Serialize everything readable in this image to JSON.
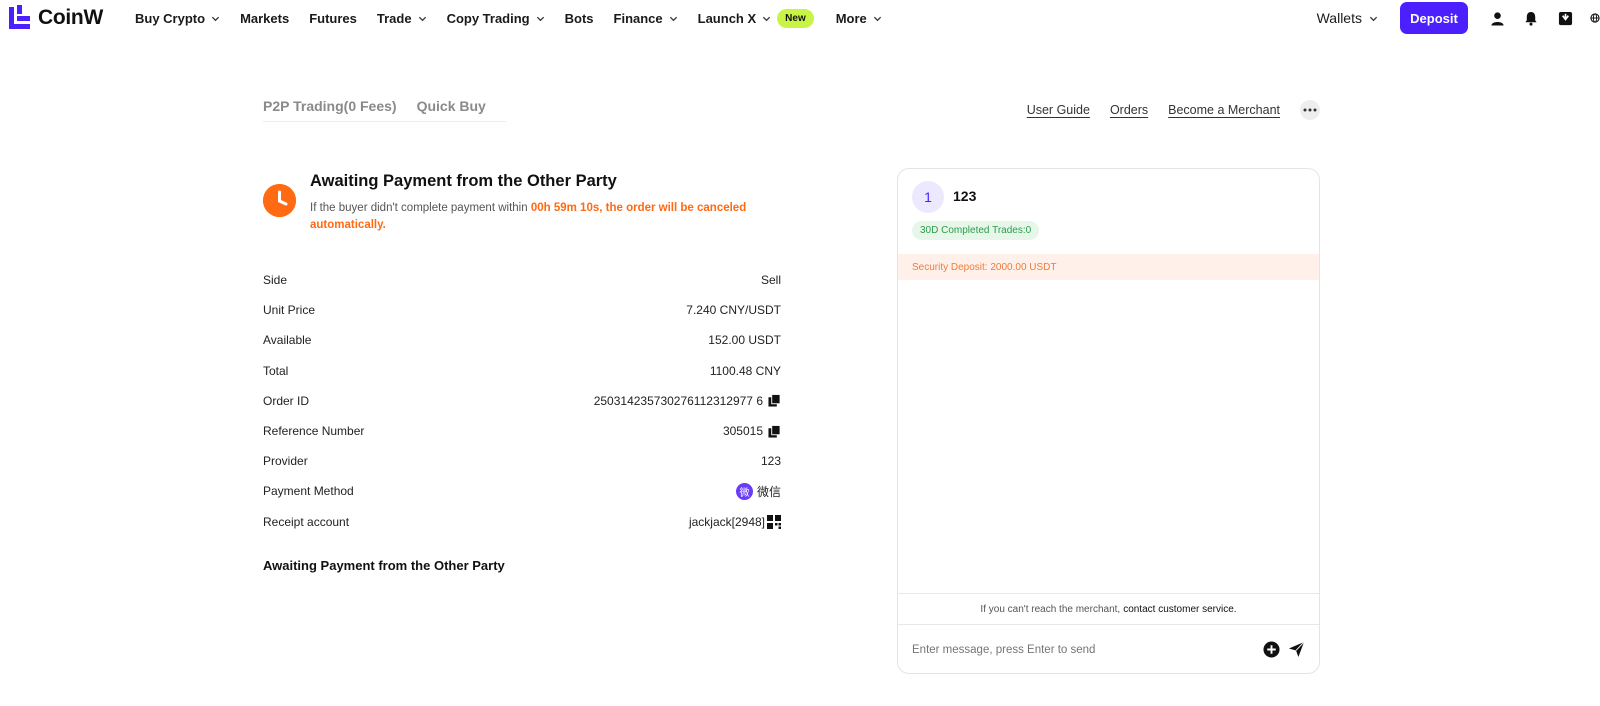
{
  "brand": {
    "name": "CoinW",
    "accent": "#4c1fff",
    "logo_color": "#4c1fff"
  },
  "nav": {
    "items": [
      {
        "label": "Buy Crypto",
        "dropdown": true
      },
      {
        "label": "Markets",
        "dropdown": false
      },
      {
        "label": "Futures",
        "dropdown": false
      },
      {
        "label": "Trade",
        "dropdown": true
      },
      {
        "label": "Copy Trading",
        "dropdown": true
      },
      {
        "label": "Bots",
        "dropdown": false
      },
      {
        "label": "Finance",
        "dropdown": true
      },
      {
        "label": "Launch X",
        "dropdown": true
      },
      {
        "label": "More",
        "dropdown": true
      }
    ],
    "new_badge": "New",
    "wallets_label": "Wallets",
    "deposit_label": "Deposit",
    "icons": [
      "user-icon",
      "bell-icon",
      "download-icon",
      "globe-icon"
    ]
  },
  "subnav": {
    "tabs": [
      "P2P Trading(0 Fees)",
      "Quick Buy"
    ],
    "links": [
      "User Guide",
      "Orders",
      "Become a Merchant"
    ],
    "more": "..."
  },
  "status": {
    "title": "Awaiting Payment from the Other Party",
    "desc_prefix": "If the buyer didn't complete payment within ",
    "desc_highlight": "00h 59m 10s, the order will be canceled automatically.",
    "icon": "clock-icon",
    "color": "#ff6a13"
  },
  "details": [
    {
      "label": "Side",
      "value": "Sell"
    },
    {
      "label": "Unit Price",
      "value": "7.240 CNY/USDT"
    },
    {
      "label": "Available",
      "value": "152.00 USDT"
    },
    {
      "label": "Total",
      "value": "1100.48 CNY"
    },
    {
      "label": "Order ID",
      "value": "250314235730276112312977 6"
    },
    {
      "label": "Reference Number",
      "value": "305015"
    },
    {
      "label": "Provider",
      "value": "123"
    },
    {
      "label": "Payment Method",
      "value": "微信"
    },
    {
      "label": "Receipt account",
      "value": "jackjack[2948]"
    }
  ],
  "section_title": "Awaiting Payment from the Other Party",
  "chat": {
    "avatar": "1",
    "name": "123",
    "trades": "30D Completed Trades:0",
    "security_deposit": "Security Deposit: 2000.00 USDT",
    "footer_text": "If you can't reach the merchant,",
    "footer_link": "contact customer service.",
    "placeholder": "Enter message, press Enter to send"
  }
}
